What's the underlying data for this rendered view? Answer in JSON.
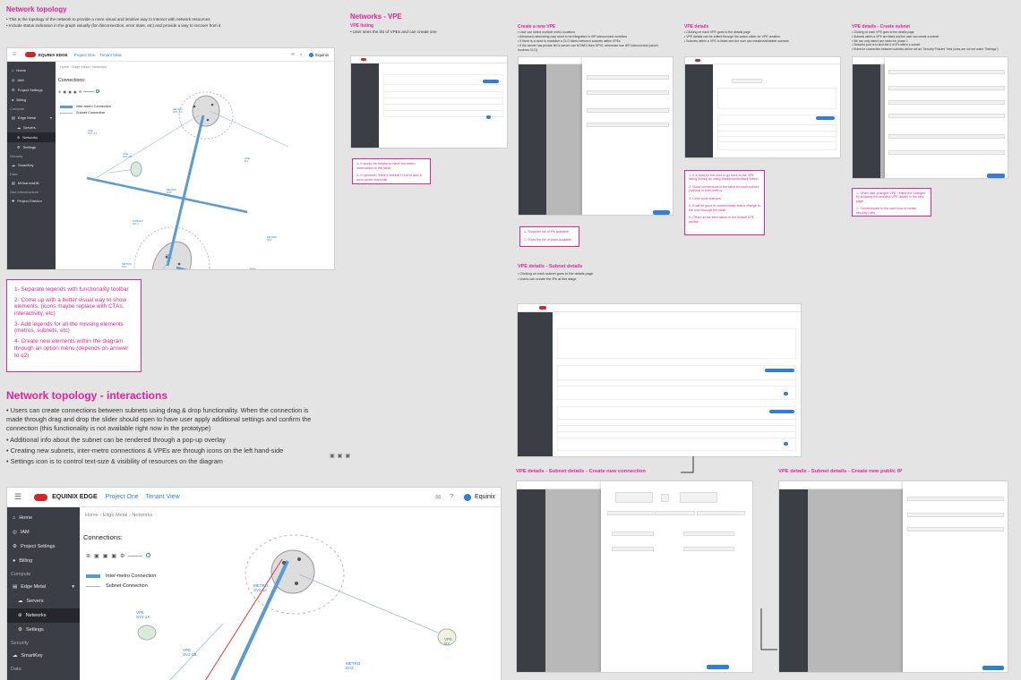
{
  "sections": {
    "topology": {
      "title": "Network topology",
      "bullets": [
        "• This is the topology of the network to provide a more visual and intuitive way to interact with network resources",
        "• Include status indication in the graph visually (for disconnection, error state, etc) and provide a way to recover from it"
      ],
      "note": [
        "1- Separate legends with functionality toolbar",
        "2- Come up with a better visual way to show elements. (icons maybe replace with CTAs, interactivity, etc)",
        "3- Add legends for all the missing elements (metros, subnets, etc)",
        "4- Create new elements within the diagram through an option menu (depends on answer to q2)"
      ]
    },
    "interactions": {
      "title": "Network topology - interactions",
      "bullets": [
        "• Users can create connections between subnets using drag & drop functionality. When the connection is made through drag and drop the slider should open to have user apply additional settings and confirm the connection (this functionality is not available right now in the prototype)",
        "• Additional info about the subnet can be rendered through a pop-up overlay",
        "• Creating new subnets, inter-metro connections & VPEs are through icons on the left hand-side",
        "• Settings icon is to control text-size & visibility of resources on the diagram"
      ]
    },
    "vpe_listing": {
      "title": "Networks - VPE",
      "sub": "VPE listing",
      "desc": "• User sees the list of VPEs and can create one",
      "note": [
        "1- It would be helpful to have the metro information in the table",
        "2- In general I think it wouldn't hurt to add a desc under each tab"
      ]
    },
    "create_vpe": {
      "title": "Create a new VPE",
      "bullets": [
        "• User can select multiple metro locations",
        "• Advanced networking may need to be integrated in IXP interconnect workflow",
        "• If there is a need to establish a CLO fabric between subnets within VPEs",
        "• If the server has private NICs server can NOWDI then GPIO, otherwise use IKP interconnect (which involves CLO)"
      ],
      "note": [
        "1- Show the list of IPs available",
        "2- Show the list of vlans available"
      ]
    },
    "vpe_details": {
      "title": "VPE details",
      "bullets": [
        "• Clicking on each VPE goes to the details page",
        "• VPE details can be edited through the action slider for VPE creation",
        "• Subnets within a VPE is listed and the user can create/edit/delete subnets"
      ],
      "note": [
        "1- It is hard for the user to go back to the VPE listing (kinda) by using Breadcrumbs/back button",
        "2- Show connections in the table for each subnet (internal or inter-metro)",
        "3- Color code statuses",
        "4- It will be good to communicate status change to the user through the slider",
        "5- Clean up the information in the default VPE section"
      ]
    },
    "create_subnet": {
      "title": "VPE details - Create subnet",
      "bullets": [
        "• Clicking on each VPE goes to the details page",
        "• Subnets within a VPE are listed and the user can create a subnet",
        "• We can only select one metro for phase 1",
        "• Selected pool is to limit the # of IPs within a subnet",
        "• Rules for connection between subnets will be set as \"Security Policies\" field (rules are not set under \"Settings\")"
      ],
      "note": [
        "1- When user changed VPE, reflect the changes by showing the selected VPE details in the next page",
        "2- Communicate to the user how to create security rules"
      ]
    },
    "subnet_details": {
      "title": "VPE details - Subnet details",
      "bullets": [
        "• Clicking on each subnet goes to the details page",
        "• Users can create the IPs at this stage"
      ]
    },
    "new_connection": {
      "title": "VPE details - Subnet details - Create new connection"
    },
    "public_ip": {
      "title": "VPE details - Subnet details - Create new public IP"
    }
  },
  "app": {
    "brand": "EQUINIX EDGE",
    "project": "Project One",
    "tenant": "Tenant View",
    "user": "Equinix",
    "breadcrumbs": [
      "Home",
      "Edge Metal",
      "Networks"
    ],
    "crumb_sep": "›",
    "sidebar": {
      "home": "Home",
      "iam": "IAM",
      "project_settings": "Project Settings",
      "billing": "Billing",
      "compute": "Compute",
      "edge_metal": "Edge Metal",
      "servers": "Servers",
      "networks": "Networks",
      "settings": "Settings",
      "security": "Security",
      "smartkey": "SmartKey",
      "data": "Data",
      "mxbarrow": "MXbarrowDB",
      "roles": "Non Infrastructure",
      "project_director": "Project Director"
    },
    "connections_label": "Connections:",
    "legend": {
      "inter_metro": "Inter-metro Connection",
      "subnet": "Subnet Connection"
    },
    "diagram": {
      "metro1": "METRO\nSV1-1A",
      "metro2": "METRO\nDA2",
      "vpe1": "VPE\nSV1-1A",
      "vpe2": "VPE\nSV1-1B",
      "subnet": "SUBNET\nDA-1",
      "vpe3": "VPE\nNY",
      "vpe4": "VPE\nDA-3",
      "metro3": "METRO\nSV1",
      "metro4": "METRO\nSV1"
    }
  },
  "colors": {
    "accent": "#e0259a",
    "brand": "#d0272d",
    "link": "#2f7fd5",
    "sidebar": "#3b3e45"
  }
}
